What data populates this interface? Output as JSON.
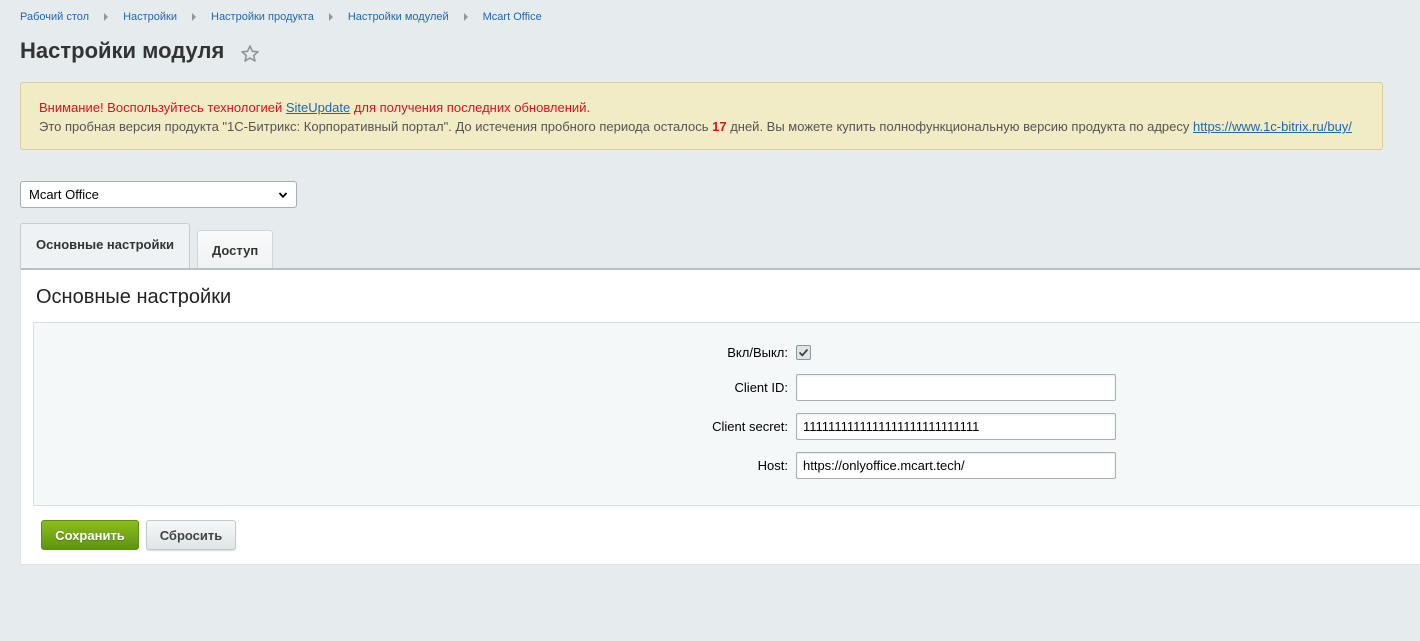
{
  "breadcrumb": [
    "Рабочий стол",
    "Настройки",
    "Настройки продукта",
    "Настройки модулей",
    "Mcart Office"
  ],
  "page_title": "Настройки модуля",
  "notice": {
    "warn_prefix": "Внимание! Воспользуйтесь технологией ",
    "warn_link": "SiteUpdate",
    "warn_suffix": " для получения последних обновлений.",
    "info_prefix": "Это пробная версия продукта \"1С-Битрикс: Корпоративный портал\". До истечения пробного периода осталось ",
    "days": "17",
    "info_middle": " дней. Вы можете купить полнофункциональную версию продукта по адресу ",
    "info_link": "https://www.1c-bitrix.ru/buy/"
  },
  "module_select": {
    "selected": "Mcart Office"
  },
  "tabs": [
    {
      "label": "Основные настройки",
      "active": true
    },
    {
      "label": "Доступ",
      "active": false
    }
  ],
  "panel": {
    "title": "Основные настройки",
    "fields": {
      "enabled_label": "Вкл/Выкл:",
      "enabled_checked": true,
      "client_id_label": "Client ID:",
      "client_id_value": "",
      "client_secret_label": "Client secret:",
      "client_secret_value": "1111111111111111111111111111",
      "host_label": "Host:",
      "host_value": "https://onlyoffice.mcart.tech/"
    },
    "save_label": "Сохранить",
    "reset_label": "Сбросить"
  },
  "colors": {
    "accent_green": "#6ea614",
    "link": "#2067b0",
    "warning": "#d6141e"
  }
}
